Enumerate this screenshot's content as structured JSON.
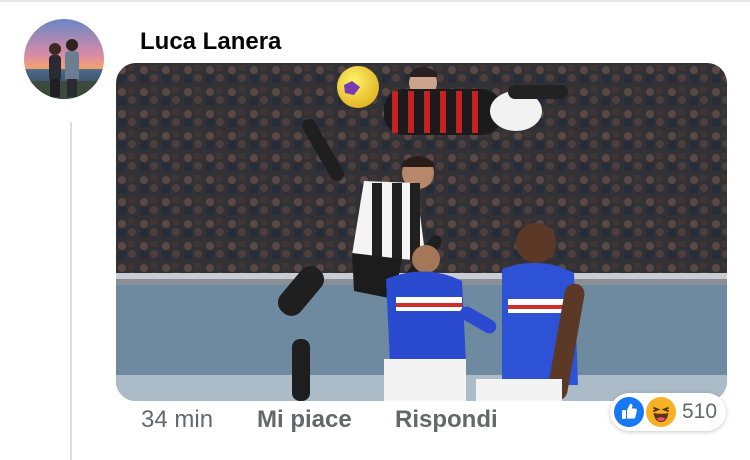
{
  "comment": {
    "author": "Luca Lanera",
    "time": "34 min",
    "actions": {
      "like_label": "Mi piace",
      "reply_label": "Rispondi"
    },
    "reactions": {
      "count": "510",
      "types": [
        "like-icon",
        "haha-icon"
      ]
    }
  },
  "colors": {
    "like_blue": "#1877f2",
    "haha_yellow": "#f7b125",
    "meta_gray": "#65676b",
    "author_text": "#050505",
    "thread_line": "#dadde1"
  }
}
